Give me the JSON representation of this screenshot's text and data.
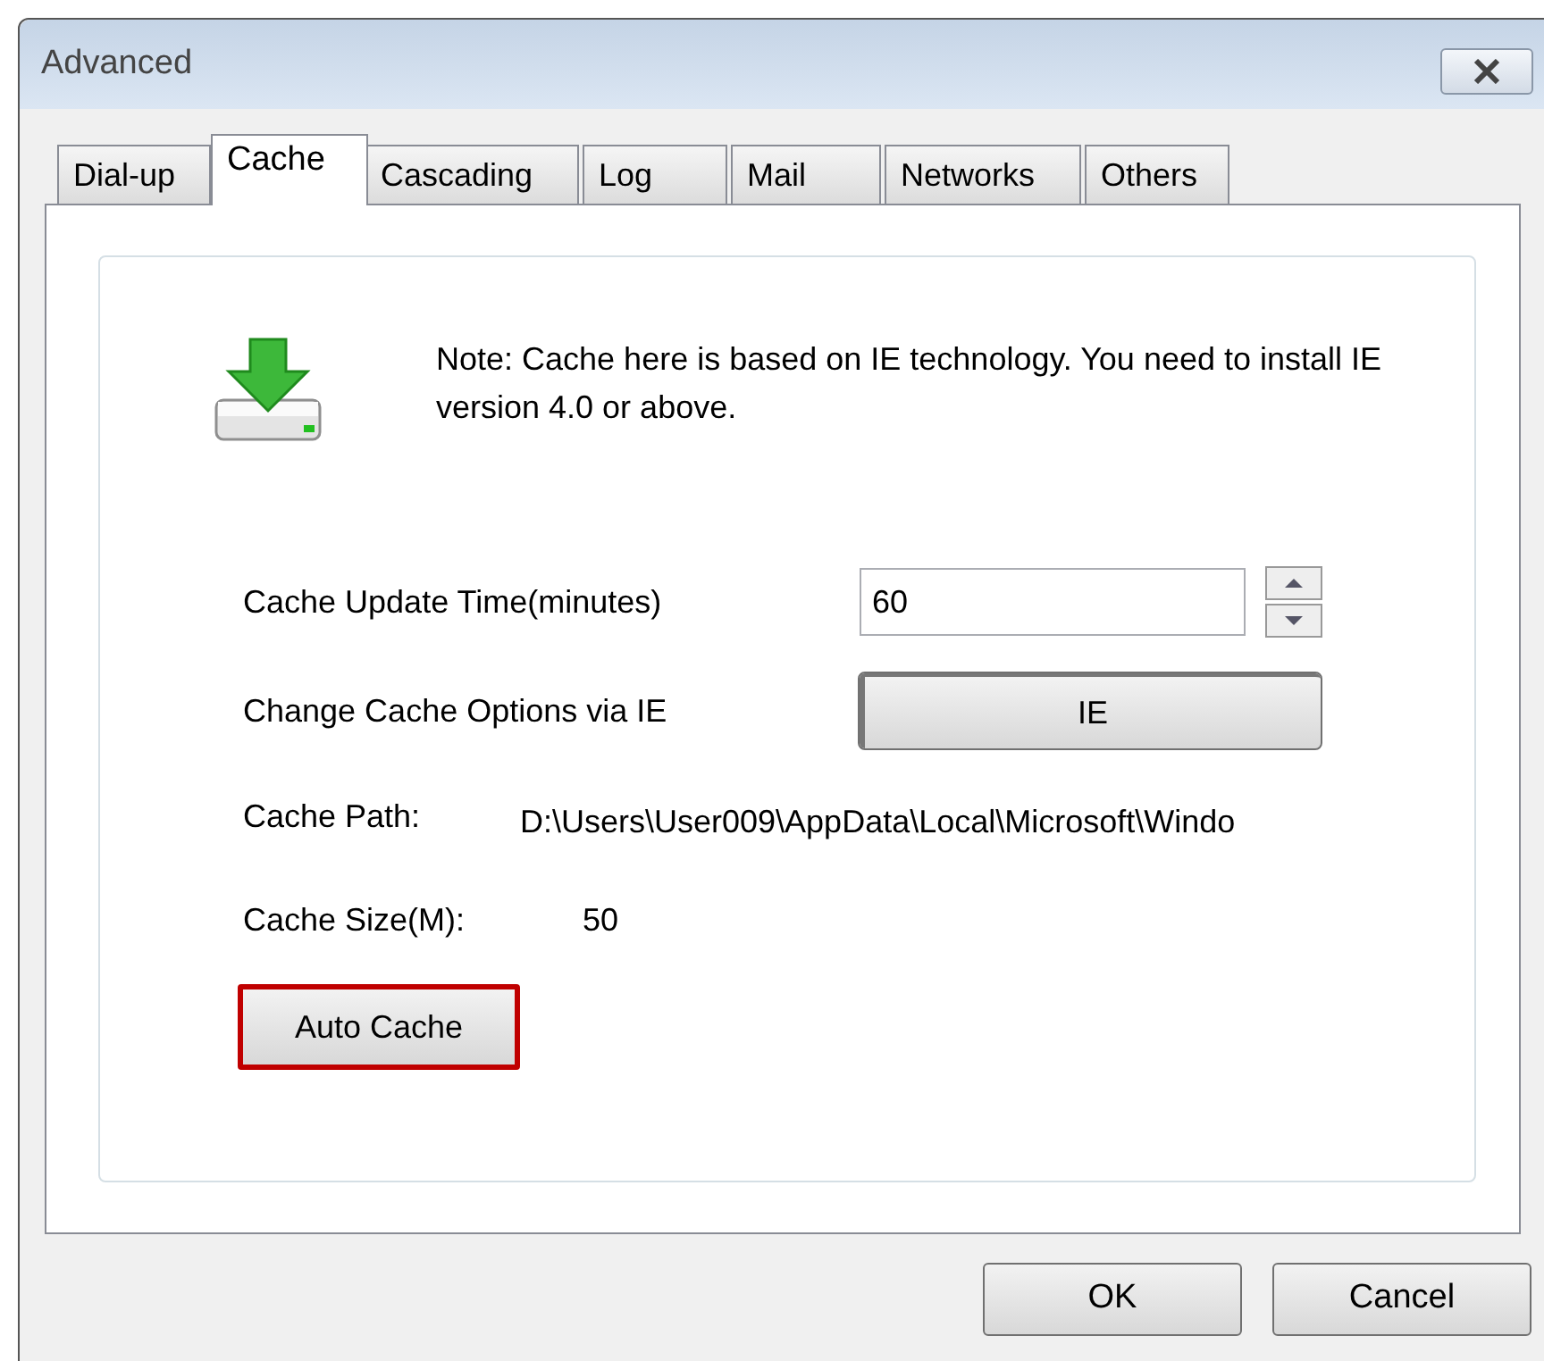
{
  "window": {
    "title": "Advanced"
  },
  "tabs": [
    {
      "label": "Dial-up",
      "selected": false
    },
    {
      "label": "Cache",
      "selected": true
    },
    {
      "label": "Cascading",
      "selected": false
    },
    {
      "label": "Log",
      "selected": false
    },
    {
      "label": "Mail",
      "selected": false
    },
    {
      "label": "Networks",
      "selected": false
    },
    {
      "label": "Others",
      "selected": false
    }
  ],
  "note": "Note: Cache here is based on IE technology. You need to install IE version 4.0 or above.",
  "update_time": {
    "label": "Cache Update Time(minutes)",
    "value": "60"
  },
  "change_options": {
    "label": "Change Cache Options via IE",
    "button": "IE"
  },
  "cache_path": {
    "label": "Cache Path:",
    "value": "D:\\Users\\User009\\AppData\\Local\\Microsoft\\Windo"
  },
  "cache_size": {
    "label": "Cache Size(M):",
    "value": "50"
  },
  "auto_cache": {
    "label": "Auto Cache",
    "focused": true
  },
  "buttons": [
    {
      "label": "OK"
    },
    {
      "label": "Cancel"
    }
  ]
}
